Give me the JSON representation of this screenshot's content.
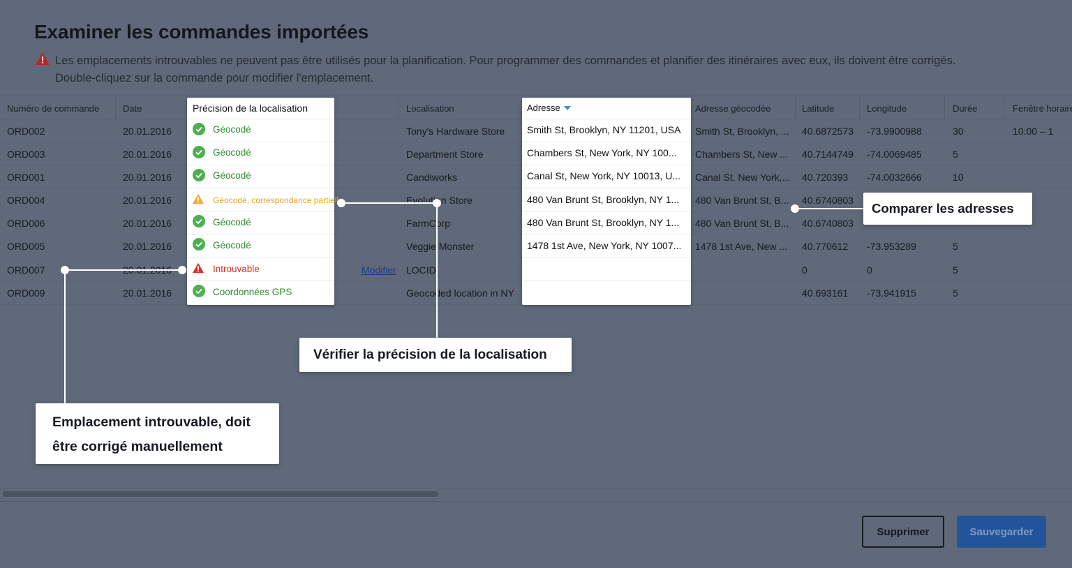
{
  "title": "Examiner les commandes importées",
  "notice": {
    "line1": "Les emplacements introuvables ne peuvent pas être utilisés pour la planification. Pour programmer des commandes et planifier des itinéraires avec eux, ils doivent être corrigés.",
    "line2": "Double-cliquez sur la commande pour modifier l'emplacement."
  },
  "columns": {
    "order": "Numéro de commande",
    "date": "Date",
    "precision": "Précision de la localisation",
    "location": "Localisation",
    "address": "Adresse",
    "geocoded": "Adresse géocodée",
    "latitude": "Latitude",
    "longitude": "Longitude",
    "duration": "Durée",
    "window": "Fenêtre horaire"
  },
  "rows": [
    {
      "order": "ORD002",
      "date": "20.01.2016",
      "status": "Géocodé",
      "location": "Tony's Hardware Store",
      "address": "Smith St, Brooklyn, NY 11201, USA",
      "geocoded": "Smith St, Brooklyn, ...",
      "latitude": "40.6872573",
      "longitude": "-73.9900988",
      "duration": "30",
      "window": "10:00 – 1"
    },
    {
      "order": "ORD003",
      "date": "20.01.2016",
      "status": "Géocodé",
      "location": "Department Store",
      "address": "Chambers St, New York, NY 100...",
      "geocoded": "Chambers St, New ...",
      "latitude": "40.7144749",
      "longitude": "-74.0069485",
      "duration": "5",
      "window": ""
    },
    {
      "order": "ORD001",
      "date": "20.01.2016",
      "status": "Géocodé",
      "location": "Candiworks",
      "address": "Canal St, New York, NY 10013, U...",
      "geocoded": "Canal St, New York,...",
      "latitude": "40.720393",
      "longitude": "-74.0032666",
      "duration": "10",
      "window": ""
    },
    {
      "order": "ORD004",
      "date": "20.01.2016",
      "status": "Géocodé, correspondance partielle",
      "location": "Evolution Store",
      "address": "480 Van Brunt St, Brooklyn, NY 1...",
      "geocoded": "480 Van Brunt St, B...",
      "latitude": "40.6740803",
      "longitude": "",
      "duration": "",
      "window": ""
    },
    {
      "order": "ORD006",
      "date": "20.01.2016",
      "status": "Géocodé",
      "location": "FarmCorp",
      "address": "480 Van Brunt St, Brooklyn, NY 1...",
      "geocoded": "480 Van Brunt St, B...",
      "latitude": "40.6740803",
      "longitude": "",
      "duration": "",
      "window": ""
    },
    {
      "order": "ORD005",
      "date": "20.01.2016",
      "status": "Géocodé",
      "location": "Veggie Monster",
      "address": "1478 1st Ave, New York, NY 1007...",
      "geocoded": "1478 1st Ave, New ...",
      "latitude": "40.770612",
      "longitude": "-73.953289",
      "duration": "5",
      "window": ""
    },
    {
      "order": "ORD007",
      "date": "20.01.2016",
      "status": "Introuvable",
      "location": "LOCID",
      "address": "",
      "geocoded": "",
      "latitude": "0",
      "longitude": "0",
      "duration": "5",
      "window": ""
    },
    {
      "order": "ORD009",
      "date": "20.01.2016",
      "status": "Coordonnées GPS",
      "location": "Geocoded location in NY",
      "address": "",
      "geocoded": "",
      "latitude": "40.693161",
      "longitude": "-73.941915",
      "duration": "5",
      "window": ""
    }
  ],
  "modifier_link": "Modifier",
  "callouts": {
    "compare": "Comparer les adresses",
    "verify": "Vérifier la précision de la localisation",
    "manual_line1": "Emplacement introuvable, doit",
    "manual_line2": "être corrigé manuellement"
  },
  "buttons": {
    "delete": "Supprimer",
    "save": "Sauvegarder"
  },
  "colors": {
    "ok": "#2e8b2e",
    "partial": "#e7a31b",
    "missing": "#d9302c",
    "primary": "#23549a",
    "overlay": "#5f6979"
  }
}
